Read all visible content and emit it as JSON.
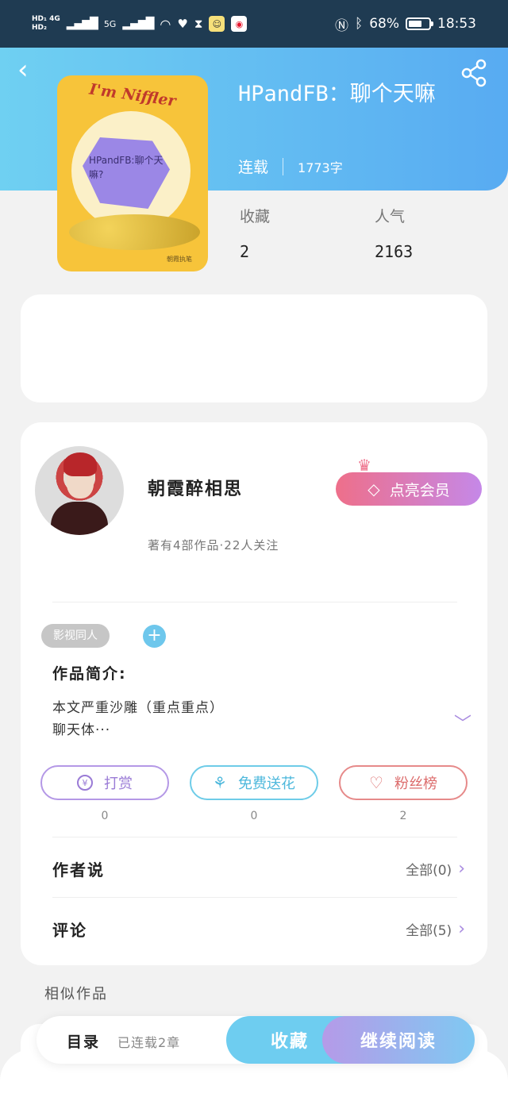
{
  "status_bar": {
    "network_top": "HD₁ 4G",
    "network_bottom": "HD₂",
    "net5g": "5G",
    "battery_text": "68%",
    "battery_level": 0.68,
    "time": "18:53"
  },
  "book": {
    "title": "HPandFB：聊个天嘛",
    "status": "连载",
    "word_count": "1773字",
    "cover_title": "I'm Niffler",
    "cover_gem_text": "HPandFB:聊个天嘛?",
    "cover_author": "朝霞执笔",
    "favorites_label": "收藏",
    "favorites_value": "2",
    "popularity_label": "人气",
    "popularity_value": "2163"
  },
  "author": {
    "name": "朝霞醉相思",
    "meta": "著有4部作品·22人关注",
    "vip_button": "点亮会员"
  },
  "tags": [
    "影视同人"
  ],
  "intro": {
    "label": "作品简介:",
    "line1": "本文严重沙雕（重点重点）",
    "line2": "聊天体···"
  },
  "actions": [
    {
      "label": "打赏",
      "count": "0"
    },
    {
      "label": "免费送花",
      "count": "0"
    },
    {
      "label": "粉丝榜",
      "count": "2"
    }
  ],
  "rows": {
    "author_says": {
      "title": "作者说",
      "more": "全部(0)"
    },
    "comments": {
      "title": "评论",
      "more": "全部(5)"
    }
  },
  "similar": {
    "title": "相似作品"
  },
  "bottom_bar": {
    "toc": "目录",
    "chapters": "已连载2章",
    "favorite": "收藏",
    "continue": "继续阅读"
  },
  "colors": {
    "header_start": "#6fd0f2",
    "header_end": "#58abf2",
    "accent_purple": "#a98be0",
    "accent_cyan": "#6ecdf0"
  }
}
